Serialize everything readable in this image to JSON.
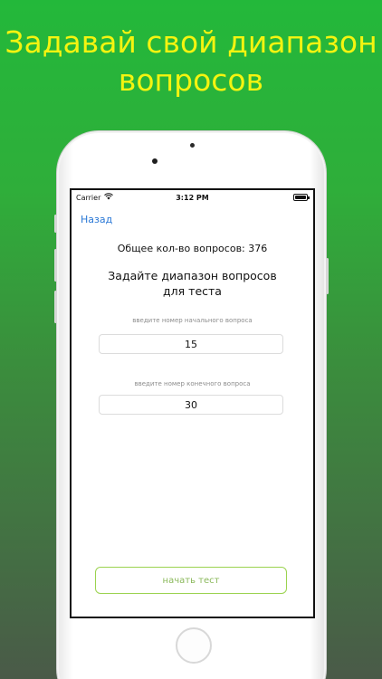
{
  "headline": {
    "line1": "Задавай свой диапазон",
    "line2": "вопросов",
    "color": "#f4f410"
  },
  "status_bar": {
    "carrier": "Carrier",
    "time": "3:12 PM",
    "wifi_icon": "wifi-icon",
    "battery_icon": "battery-icon"
  },
  "nav": {
    "back_label": "Назад"
  },
  "content": {
    "total_questions": "Общее кол-во вопросов: 376",
    "prompt_line1": "Задайте диапазон вопросов",
    "prompt_line2": "для теста",
    "start_hint": "введите номер начального вопроса",
    "start_value": "15",
    "end_hint": "введите номер конечного вопроса",
    "end_value": "30",
    "start_button": "начать тест"
  },
  "colors": {
    "background_top": "#23b83a",
    "background_bottom": "#4a5a48",
    "link": "#2a78d6",
    "button_border": "#9bd34f"
  }
}
